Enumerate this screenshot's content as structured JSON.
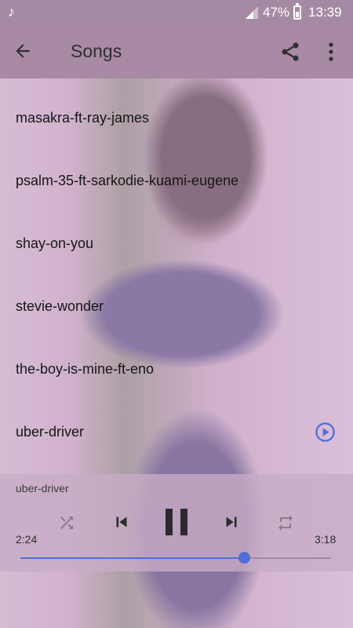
{
  "status_bar": {
    "battery": "47%",
    "time": "13:39",
    "icons": [
      "music-note-icon",
      "signal-icon",
      "battery-icon"
    ]
  },
  "app_bar": {
    "title": "Songs",
    "icons": [
      "back-arrow-icon",
      "share-icon",
      "more-vert-icon"
    ]
  },
  "songs": [
    {
      "title": "masakra-ft-ray-james"
    },
    {
      "title": "psalm-35-ft-sarkodie-kuami-eugene"
    },
    {
      "title": "shay-on-you"
    },
    {
      "title": "stevie-wonder"
    },
    {
      "title": "the-boy-is-mine-ft-eno"
    },
    {
      "title": "uber-driver",
      "playing": true
    }
  ],
  "player": {
    "now_playing": "uber-driver",
    "elapsed": "2:24",
    "total": "3:18",
    "progress": 0.72,
    "controls": [
      "shuffle-icon",
      "previous-icon",
      "pause-icon",
      "next-icon",
      "repeat-icon"
    ]
  },
  "colors": {
    "accent": "#4f6fd4",
    "app_bar": "#a88aa5",
    "status_bar": "#a68aa3"
  }
}
